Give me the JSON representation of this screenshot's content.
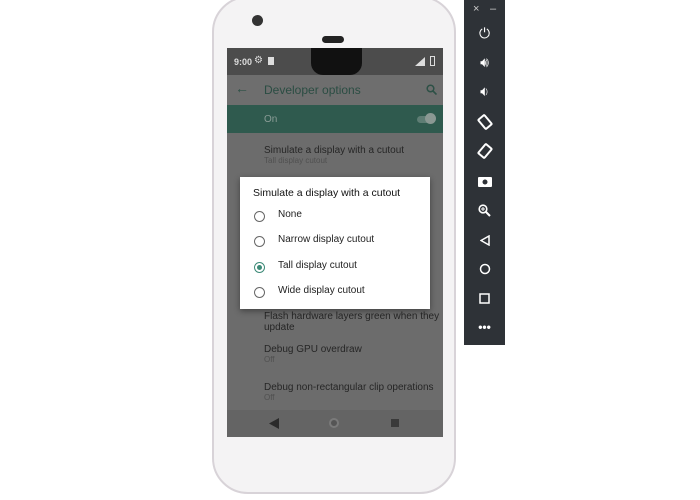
{
  "status_bar": {
    "time": "9:00",
    "settings_icon": "gear-icon",
    "sd_icon": "sd-card-icon",
    "signal_icon": "signal-icon",
    "battery_icon": "battery-icon"
  },
  "app_bar": {
    "title": "Developer options",
    "back_icon": "arrow-left-icon",
    "search_icon": "search-icon"
  },
  "master_switch": {
    "label": "On",
    "state": true
  },
  "settings": [
    {
      "title": "Simulate a display with a cutout",
      "summary": "Tall display cutout"
    },
    {
      "title": "Flash hardware layers green when they",
      "summary": "update"
    },
    {
      "title": "Debug GPU overdraw",
      "summary": "Off"
    },
    {
      "title": "Debug non-rectangular clip operations",
      "summary": "Off"
    }
  ],
  "dialog": {
    "title": "Simulate a display with a cutout",
    "options": [
      {
        "label": "None",
        "selected": false
      },
      {
        "label": "Narrow display cutout",
        "selected": false
      },
      {
        "label": "Tall display cutout",
        "selected": true
      },
      {
        "label": "Wide display cutout",
        "selected": false
      }
    ],
    "accent": "#3d8a77"
  },
  "nav_bar": {
    "back": "back-triangle-icon",
    "home": "home-circle-icon",
    "recents": "recents-square-icon"
  },
  "emulator_toolbar": {
    "close": "×",
    "minimize": "–",
    "buttons": [
      "power-icon",
      "volume-up-icon",
      "volume-down-icon",
      "rotate-left-icon",
      "rotate-right-icon",
      "camera-icon",
      "zoom-icon",
      "back-icon",
      "home-icon",
      "overview-icon",
      "more-icon"
    ]
  }
}
